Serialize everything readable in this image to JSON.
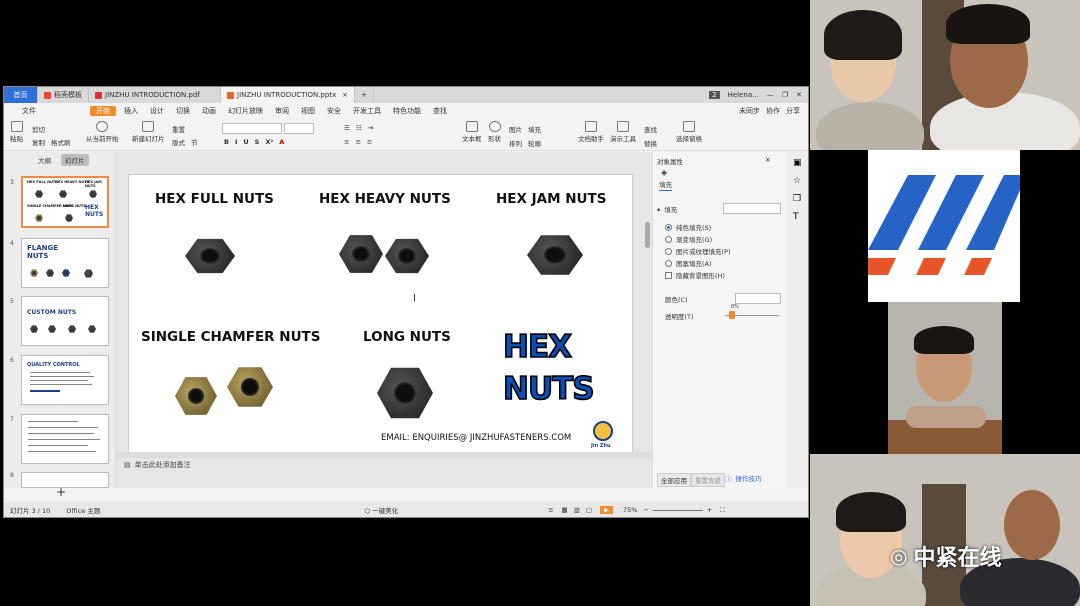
{
  "tabs": [
    {
      "label": "首页"
    },
    {
      "label": "稻壳模板"
    },
    {
      "label": "JINZHU INTRODUCTION.pdf"
    },
    {
      "label": "JINZHU INTRODUCTION.pptx"
    }
  ],
  "tab_badge": "2",
  "user_name": "Helena...",
  "menus": [
    "文件",
    "开始",
    "插入",
    "设计",
    "切换",
    "动画",
    "幻灯片放映",
    "审阅",
    "视图",
    "安全",
    "开发工具",
    "特色功能",
    "查找"
  ],
  "menu_right": [
    "未同步",
    "协作",
    "分享"
  ],
  "toolbar": {
    "paste": "粘贴",
    "cut": "剪切",
    "copy": "复制",
    "format_painter": "格式刷",
    "from_current": "从当前开始",
    "new_slide": "新建幻灯片",
    "layout": "版式",
    "section": "节",
    "reset": "重置",
    "textbox": "文本框",
    "shape": "形状",
    "arrange": "排列",
    "picture": "图片",
    "fill": "填充",
    "outline": "轮廓",
    "text_helper": "文档助手",
    "present_tool": "演示工具",
    "find": "查找",
    "replace": "替换",
    "select_pane": "选择窗格"
  },
  "left_panel": {
    "outline": "大纲",
    "slides": "幻灯片"
  },
  "thumbs": [
    {
      "num": "3",
      "lines": [
        "HEX FULL NUTS",
        "HEX HEAVY NUTS",
        "HEX JAM NUTS",
        "SINGLE CHAMFER NUTS",
        "LONG NUTS",
        "HEX NUTS"
      ]
    },
    {
      "num": "4",
      "title": "FLANGE NUTS"
    },
    {
      "num": "5",
      "title": "CUSTOM NUTS"
    },
    {
      "num": "6",
      "title": "QUALITY CONTROL"
    },
    {
      "num": "7"
    },
    {
      "num": "8"
    }
  ],
  "slide": {
    "t1": "HEX  FULL NUTS",
    "t2": "HEX HEAVY NUTS",
    "t3": "HEX JAM NUTS",
    "t4": "SINGLE CHAMFER NUTS",
    "t5": "LONG NUTS",
    "big1": "HEX",
    "big2": "NUTS",
    "email": "EMAIL: ENQUIRIES@ JINZHUFASTENERS.COM",
    "logo_text": "Jin Zhu"
  },
  "notes_placeholder": "单击此处添加备注",
  "right_panel": {
    "title": "对象属性",
    "fill_tab": "填充",
    "fill_section": "填充",
    "options": [
      "纯色填充(S)",
      "渐变填充(G)",
      "图片或纹理填充(P)",
      "图案填充(A)"
    ],
    "hide_bg": "隐藏背景图形(H)",
    "color_label": "颜色(C)",
    "transparency_label": "透明度(T)",
    "transparency_value": "0%",
    "apply_all": "全部应用",
    "reset_bg": "重置背景",
    "tips": "操作技巧"
  },
  "status": {
    "slide_pos": "幻灯片 3 / 10",
    "theme": "Office 主题",
    "beautify": "一键美化",
    "zoom": "75%"
  },
  "watermark": "中紧在线",
  "colors": {
    "accent": "#f28c28",
    "blue": "#2f6fd8",
    "slide_blue": "#0a4fb8"
  }
}
